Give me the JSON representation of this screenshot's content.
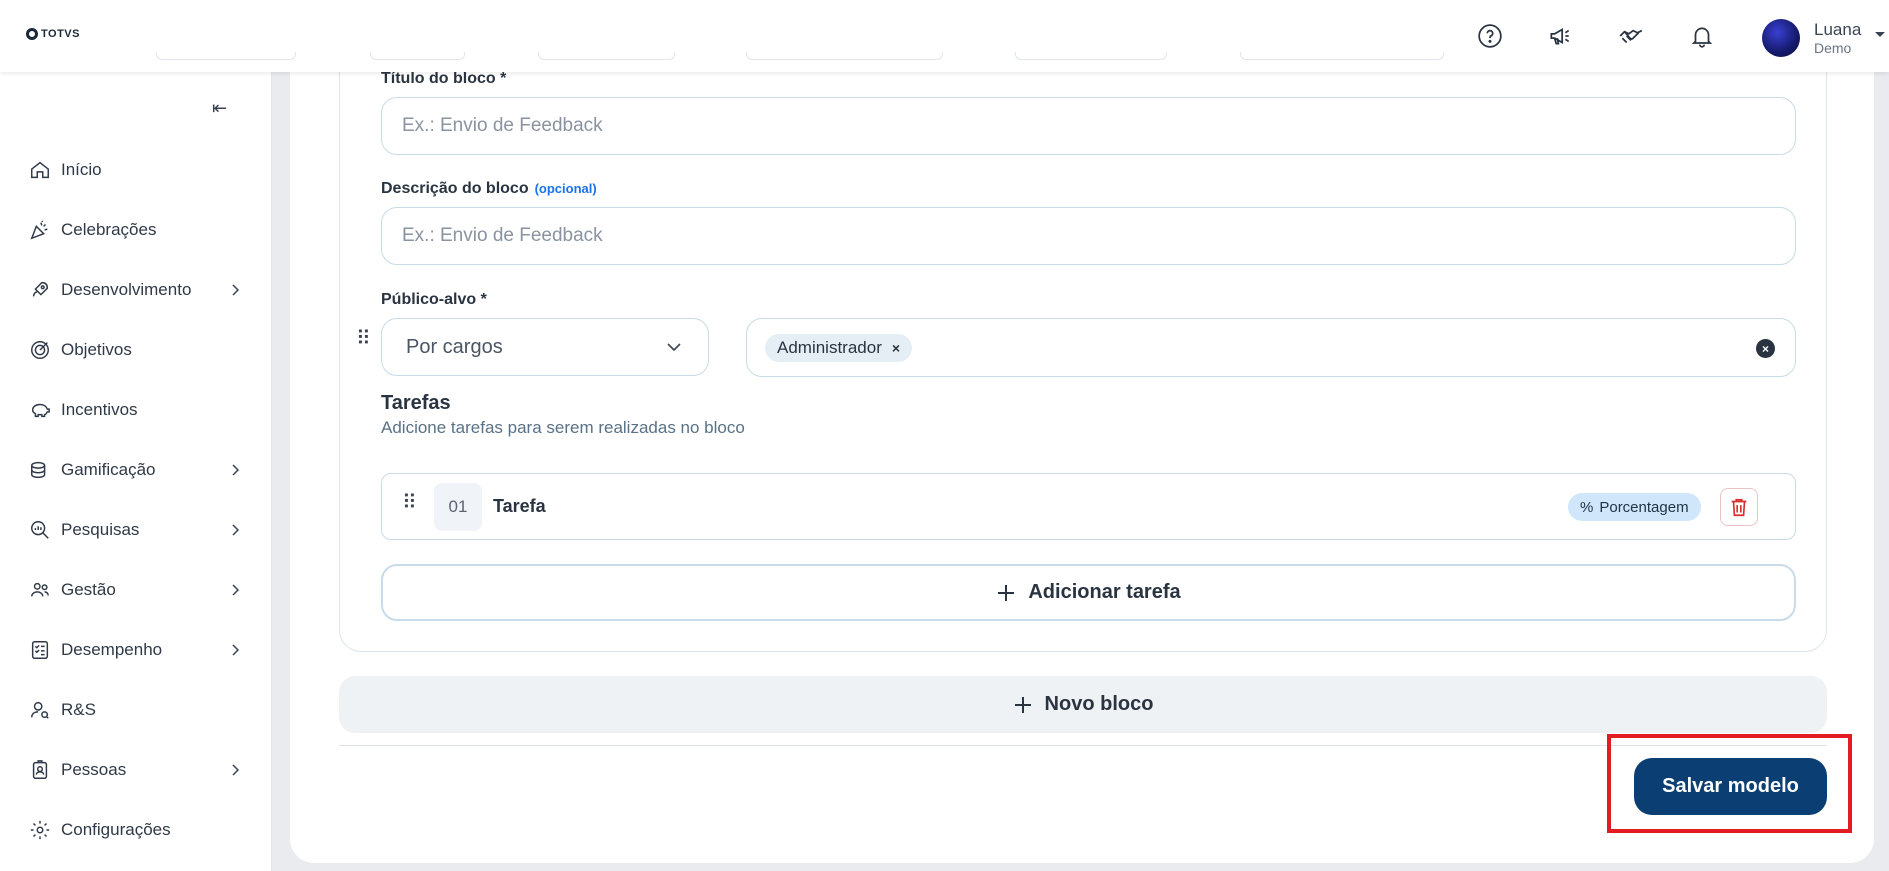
{
  "app": {
    "brand": "TOTVS"
  },
  "user": {
    "name": "Luana",
    "role": "Demo"
  },
  "sidebar": {
    "items": [
      {
        "label": "Início",
        "icon": "home-icon",
        "has_children": false
      },
      {
        "label": "Celebrações",
        "icon": "party-icon",
        "has_children": false
      },
      {
        "label": "Desenvolvimento",
        "icon": "rocket-icon",
        "has_children": true
      },
      {
        "label": "Objetivos",
        "icon": "target-icon",
        "has_children": false
      },
      {
        "label": "Incentivos",
        "icon": "piggy-bank-icon",
        "has_children": false
      },
      {
        "label": "Gamificação",
        "icon": "coins-icon",
        "has_children": true
      },
      {
        "label": "Pesquisas",
        "icon": "search-chart-icon",
        "has_children": true
      },
      {
        "label": "Gestão",
        "icon": "users-icon",
        "has_children": true
      },
      {
        "label": "Desempenho",
        "icon": "checklist-icon",
        "has_children": true
      },
      {
        "label": "R&S",
        "icon": "user-search-icon",
        "has_children": false
      },
      {
        "label": "Pessoas",
        "icon": "badge-icon",
        "has_children": true
      },
      {
        "label": "Configurações",
        "icon": "gear-icon",
        "has_children": false
      }
    ]
  },
  "form": {
    "title_label": "Título do bloco  *",
    "title_placeholder": "Ex.: Envio de Feedback",
    "description_label": "Descrição do bloco",
    "description_optional": "(opcional)",
    "description_placeholder": "Ex.: Envio de Feedback",
    "audience_label": "Público-alvo *",
    "audience_type": "Por cargos",
    "audience_chips": [
      "Administrador"
    ],
    "tasks_title": "Tarefas",
    "tasks_subtitle": "Adicione tarefas para serem realizadas no bloco",
    "tasks": [
      {
        "number": "01",
        "name": "Tarefa",
        "type": "Porcentagem"
      }
    ],
    "add_task_label": "Adicionar tarefa",
    "new_block_label": "Novo bloco",
    "save_label": "Salvar modelo"
  },
  "colors": {
    "primary": "#0b3f73",
    "highlight": "#e31b23",
    "badge_bg": "#cfe6fb",
    "link": "#1a73e8"
  }
}
